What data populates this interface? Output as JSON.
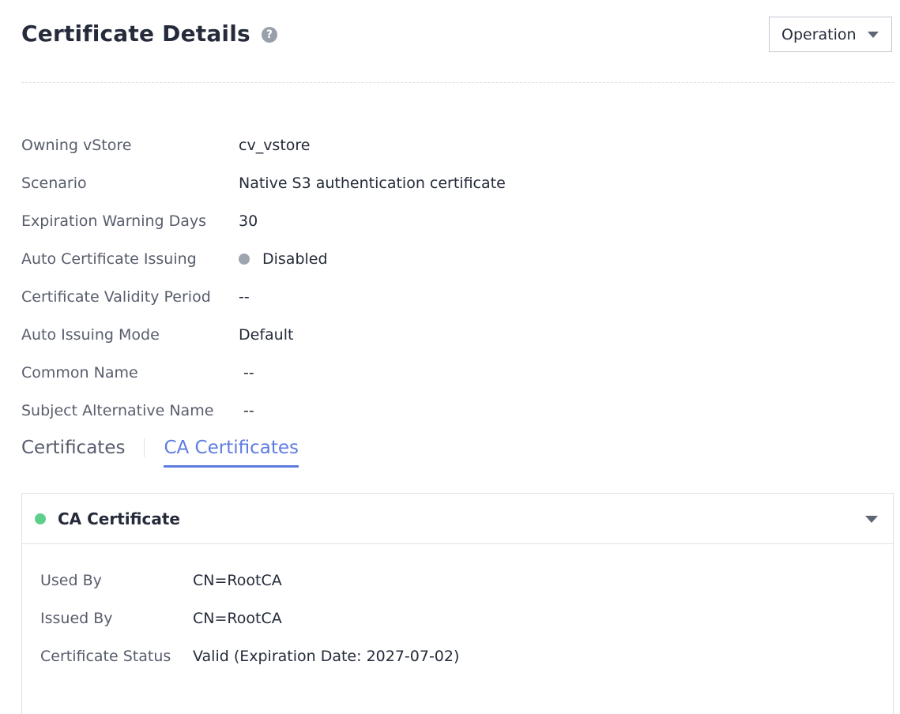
{
  "header": {
    "title": "Certificate Details",
    "help_icon": "help-icon",
    "operation_label": "Operation"
  },
  "properties": [
    {
      "label": "Owning vStore",
      "value": "cv_vstore"
    },
    {
      "label": "Scenario",
      "value": "Native S3 authentication certificate"
    },
    {
      "label": "Expiration Warning Days",
      "value": "30"
    },
    {
      "label": "Auto Certificate Issuing",
      "value": "Disabled",
      "status_color": "#9ea4b0"
    },
    {
      "label": "Certificate Validity Period",
      "value": "--"
    },
    {
      "label": "Auto Issuing Mode",
      "value": "Default"
    },
    {
      "label": "Common Name",
      "value": "--"
    },
    {
      "label": "Subject Alternative Name",
      "value": "--"
    }
  ],
  "tabs": [
    {
      "label": "Certificates",
      "active": false
    },
    {
      "label": "CA Certificates",
      "active": true
    }
  ],
  "ca_panel": {
    "title": "CA Certificate",
    "status_color": "#5ecf8b",
    "rows": [
      {
        "label": "Used By",
        "value": "CN=RootCA"
      },
      {
        "label": "Issued By",
        "value": "CN=RootCA"
      },
      {
        "label": "Certificate Status",
        "value": "Valid (Expiration Date: 2027-07-02)"
      }
    ]
  },
  "colors": {
    "accent": "#5e7ce0",
    "text_primary": "#252b3a",
    "text_secondary": "#575d6c"
  }
}
